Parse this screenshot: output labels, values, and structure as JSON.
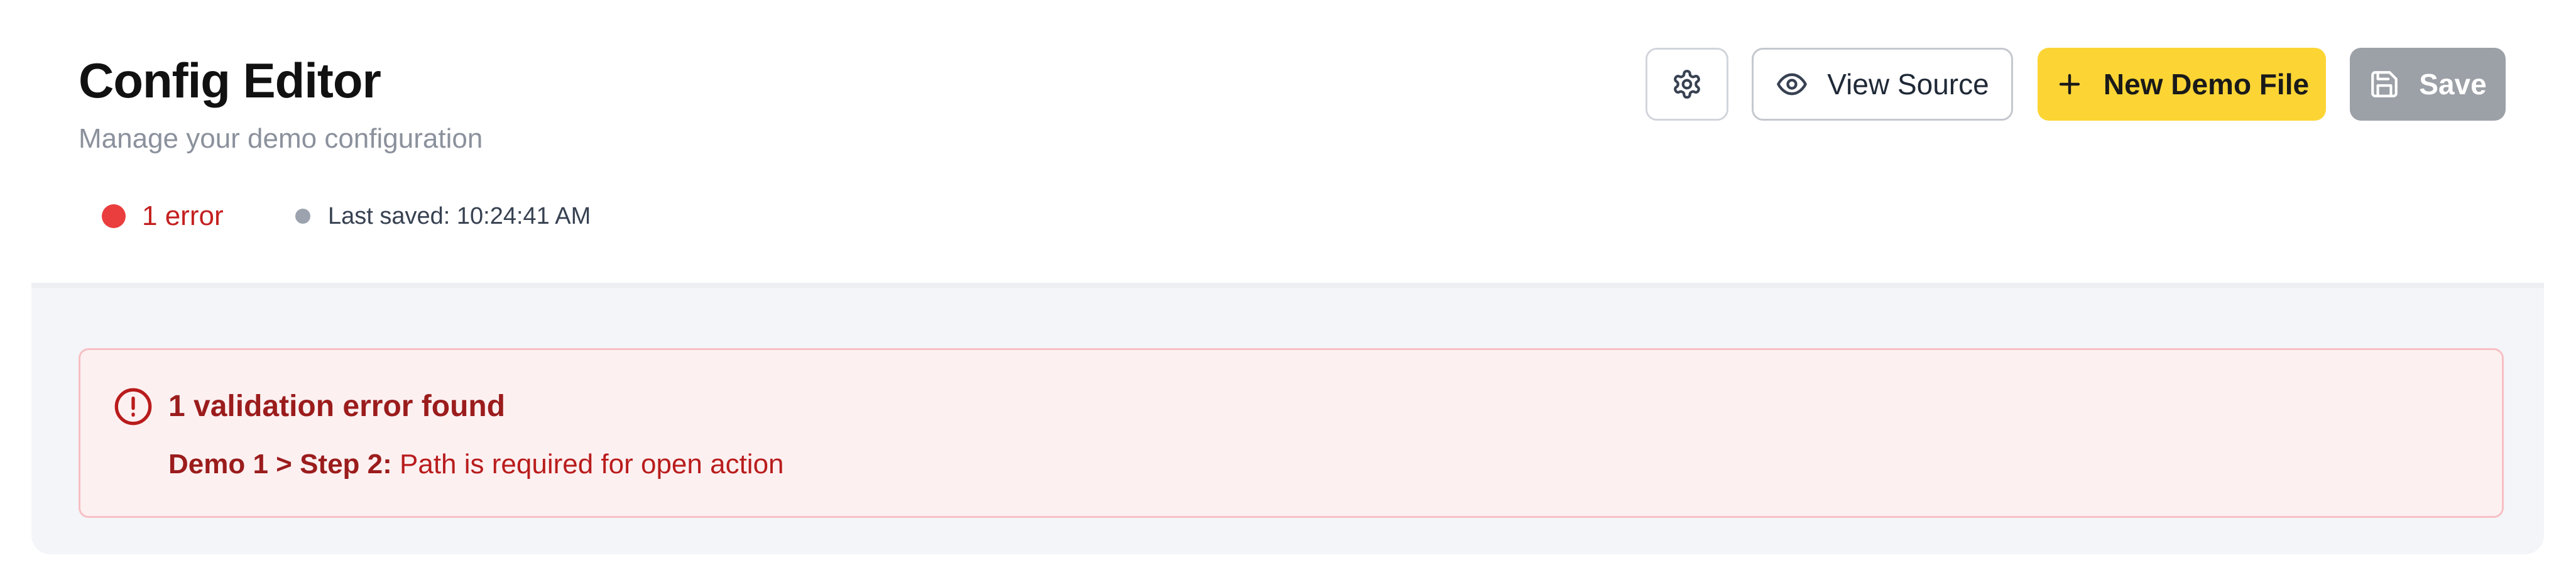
{
  "header": {
    "title": "Config Editor",
    "subtitle": "Manage your demo configuration"
  },
  "status": {
    "error_count": "1 error",
    "last_saved": "Last saved: 10:24:41 AM",
    "error_color": "#ea3e3e",
    "saved_dot_color": "#9ca3af"
  },
  "toolbar": {
    "settings_icon": "gear-icon",
    "view_source_icon": "eye-icon",
    "view_source_label": "View Source",
    "new_file_icon": "plus-icon",
    "new_file_label": "New Demo File",
    "save_icon": "floppy-disk-icon",
    "save_label": "Save",
    "accent_color": "#fcd535",
    "save_disabled_color": "#9ca0a7"
  },
  "validation": {
    "icon": "alert-circle-icon",
    "title": "1 validation error found",
    "errors": [
      {
        "location": "Demo 1 > Step 2:",
        "message": "Path is required for open action"
      }
    ],
    "background_color": "#fdf0f1",
    "text_color": "#9b1c1c"
  }
}
